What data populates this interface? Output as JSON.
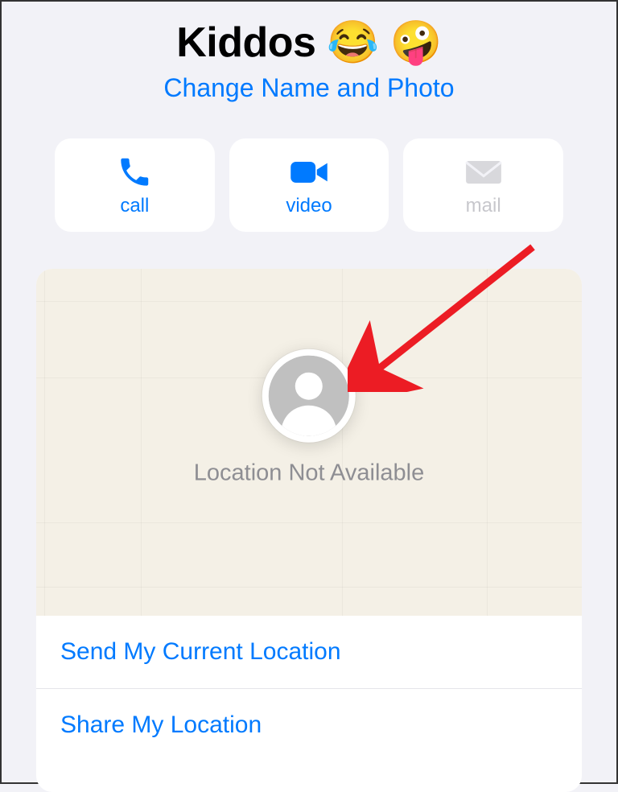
{
  "header": {
    "title": "Kiddos 😂 🤪",
    "change_link": "Change Name and Photo"
  },
  "actions": {
    "call": {
      "label": "call",
      "enabled": true
    },
    "video": {
      "label": "video",
      "enabled": true
    },
    "mail": {
      "label": "mail",
      "enabled": false
    }
  },
  "map": {
    "status_text": "Location Not Available"
  },
  "rows": {
    "send_location": "Send My Current Location",
    "share_location": "Share My Location"
  },
  "colors": {
    "accent": "#007aff",
    "bg": "#f2f2f7",
    "disabled": "#c7c7cc",
    "map_bg": "#f4f0e6",
    "text_muted": "#8e8e93"
  }
}
